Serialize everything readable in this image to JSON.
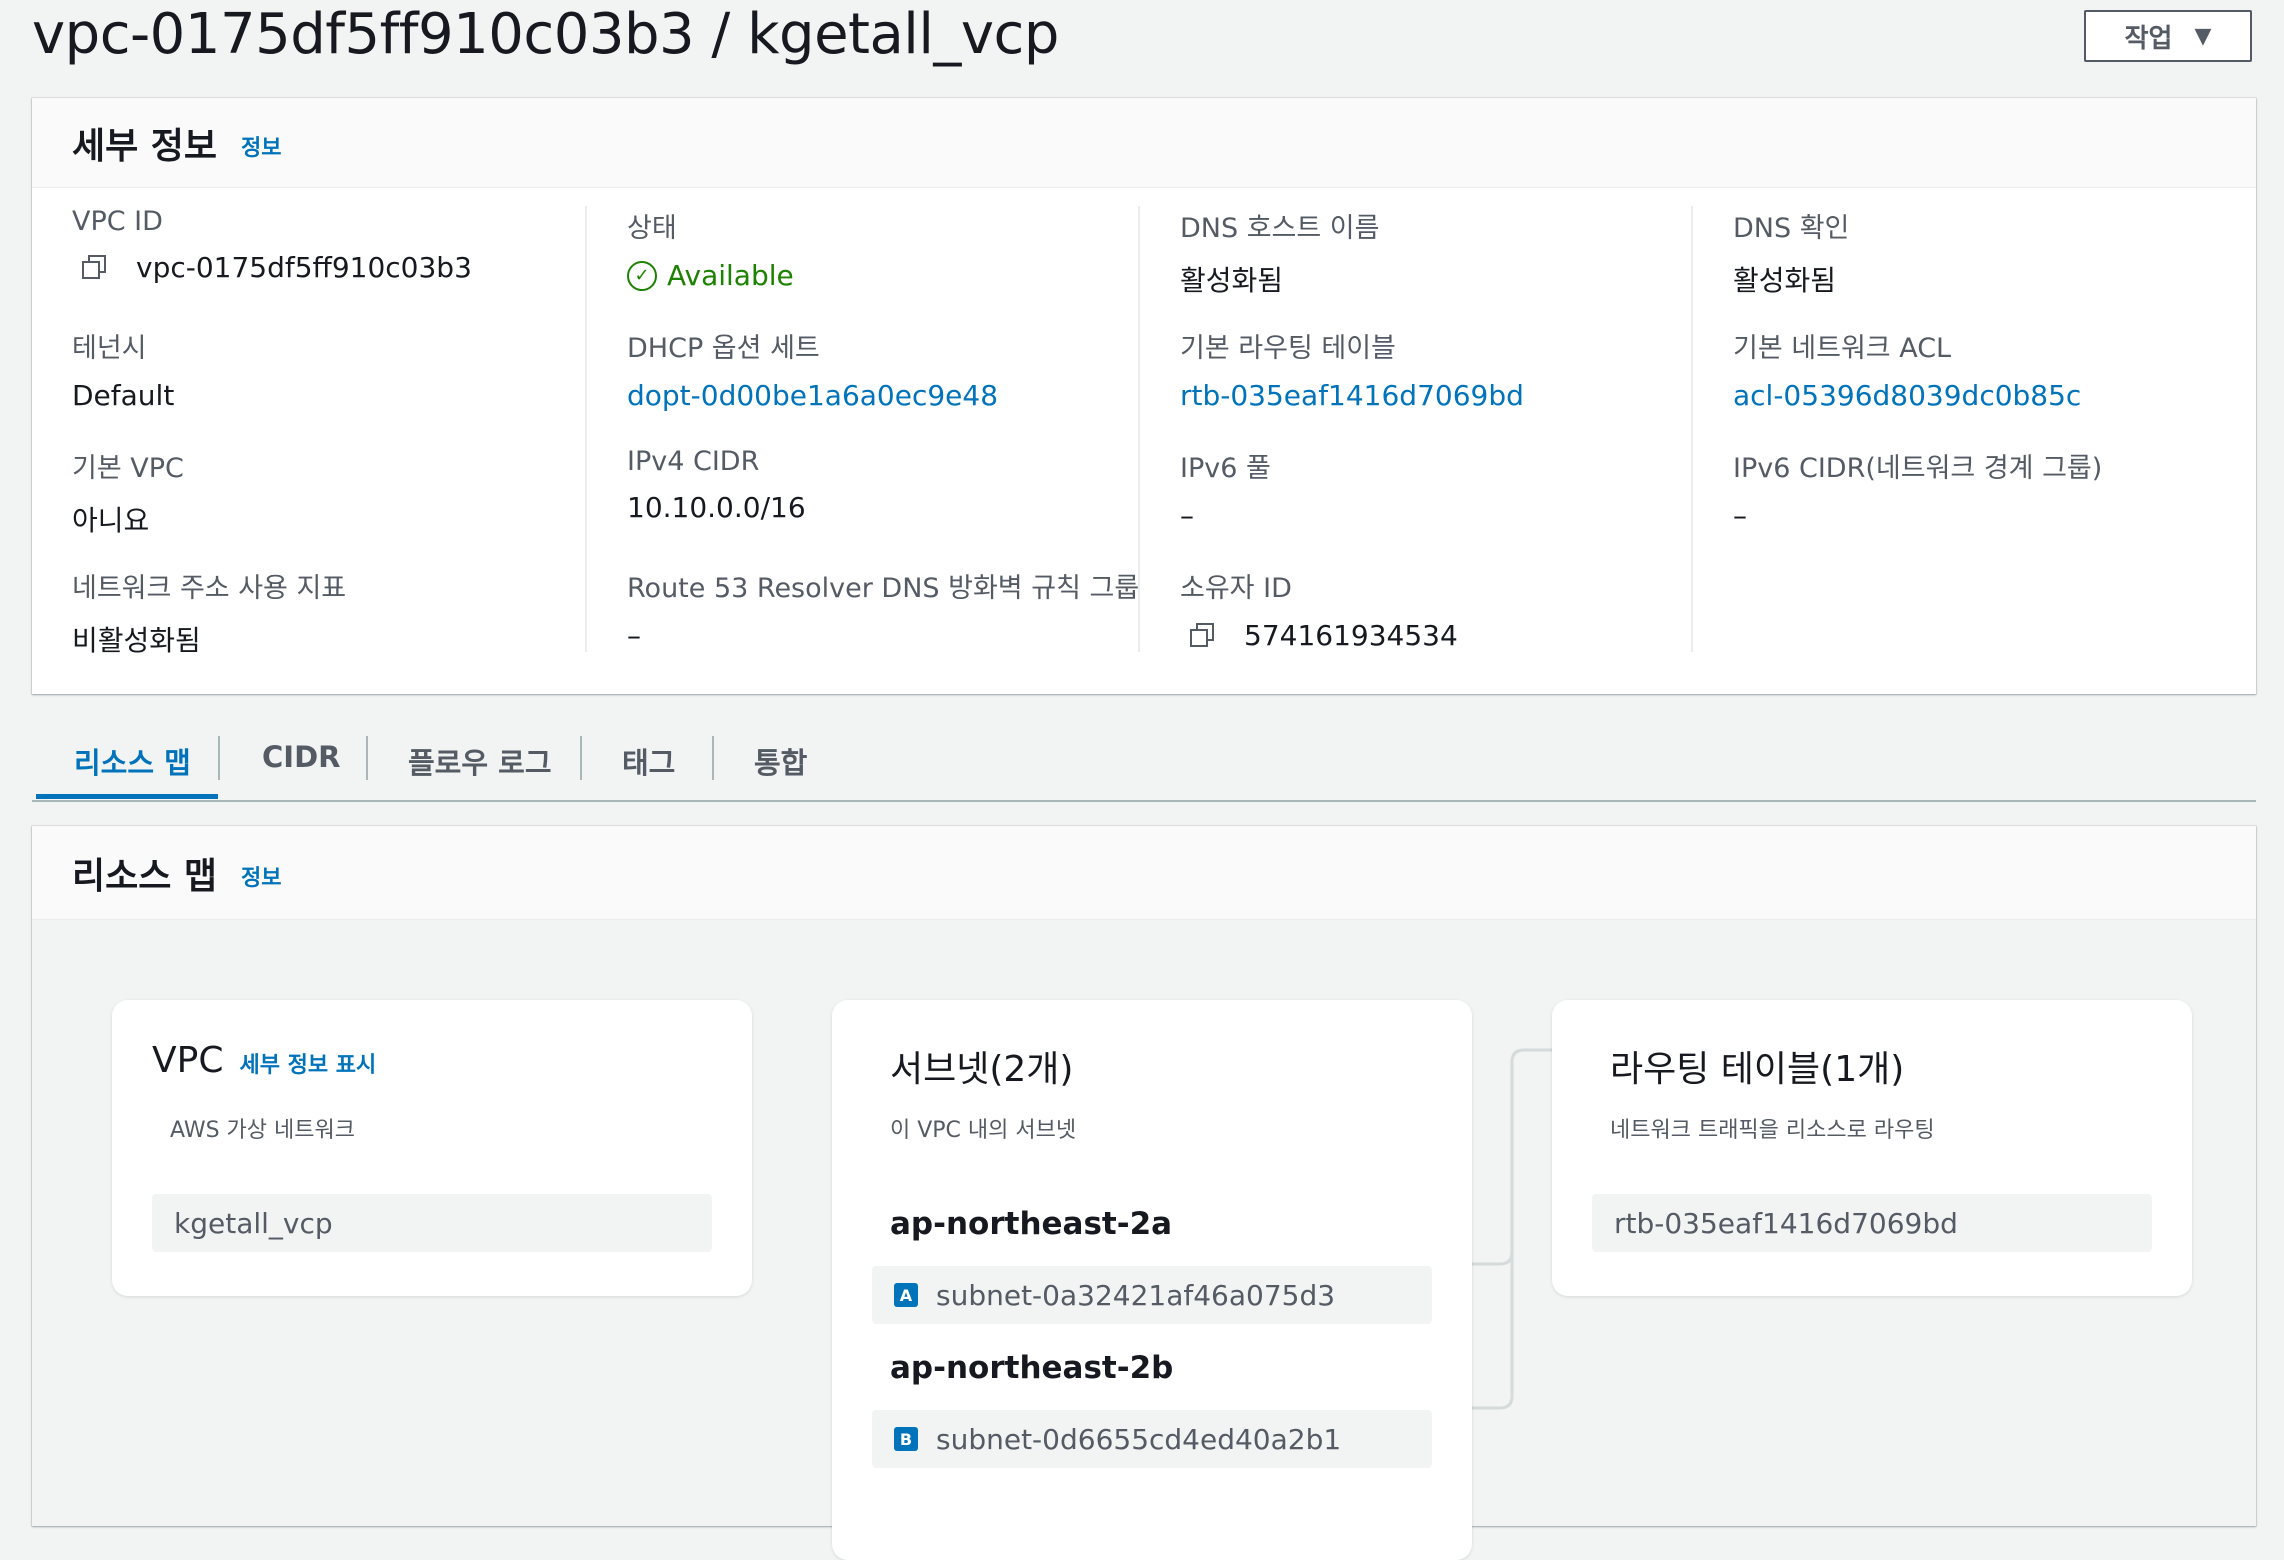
{
  "header": {
    "title": "vpc-0175df5ff910c03b3 / kgetall_vcp",
    "actions_label": "작업",
    "caret": "▼"
  },
  "details": {
    "title": "세부 정보",
    "info_link": "정보",
    "fields": {
      "vpc_id": {
        "label": "VPC ID",
        "value": "vpc-0175df5ff910c03b3"
      },
      "tenancy": {
        "label": "테넌시",
        "value": "Default"
      },
      "default_vpc": {
        "label": "기본 VPC",
        "value": "아니요"
      },
      "net_addr_usage": {
        "label": "네트워크 주소 사용 지표",
        "value": "비활성화됨"
      },
      "state": {
        "label": "상태",
        "value": "Available"
      },
      "dhcp": {
        "label": "DHCP 옵션 세트",
        "value": "dopt-0d00be1a6a0ec9e48"
      },
      "ipv4": {
        "label": "IPv4 CIDR",
        "value": "10.10.0.0/16"
      },
      "route53": {
        "label": "Route 53 Resolver DNS 방화벽 규칙 그룹",
        "value": "–"
      },
      "dns_hostnames": {
        "label": "DNS 호스트 이름",
        "value": "활성화됨"
      },
      "main_rtb": {
        "label": "기본 라우팅 테이블",
        "value": "rtb-035eaf1416d7069bd"
      },
      "ipv6_pool": {
        "label": "IPv6 풀",
        "value": "–"
      },
      "owner": {
        "label": "소유자 ID",
        "value": "574161934534"
      },
      "dns_resolution": {
        "label": "DNS 확인",
        "value": "활성화됨"
      },
      "main_acl": {
        "label": "기본 네트워크 ACL",
        "value": "acl-05396d8039dc0b85c"
      },
      "ipv6_cidr": {
        "label": "IPv6 CIDR(네트워크 경계 그룹)",
        "value": "–"
      }
    }
  },
  "tabs": [
    {
      "label": "리소스 맵",
      "active": true
    },
    {
      "label": "CIDR"
    },
    {
      "label": "플로우 로그"
    },
    {
      "label": "태그"
    },
    {
      "label": "통합"
    }
  ],
  "resource_map": {
    "title": "리소스 맵",
    "info_link": "정보",
    "vpc_card": {
      "title": "VPC",
      "link": "세부 정보 표시",
      "subtitle": "AWS 가상 네트워크",
      "item": "kgetall_vcp"
    },
    "subnets_card": {
      "title": "서브넷(2개)",
      "subtitle": "이 VPC 내의 서브넷",
      "zones": [
        {
          "name": "ap-northeast-2a",
          "badge": "A",
          "subnet": "subnet-0a32421af46a075d3"
        },
        {
          "name": "ap-northeast-2b",
          "badge": "B",
          "subnet": "subnet-0d6655cd4ed40a2b1"
        }
      ]
    },
    "rtb_card": {
      "title": "라우팅 테이블(1개)",
      "subtitle": "네트워크 트래픽을 리소스로 라우팅",
      "item": "rtb-035eaf1416d7069bd"
    }
  },
  "colors": {
    "link": "#0073bb",
    "success": "#1d8102",
    "text": "#16191f",
    "muted": "#545b64",
    "background": "#f2f3f3"
  },
  "icons": [
    "copy-icon",
    "status-available-icon",
    "dropdown-caret-icon"
  ]
}
